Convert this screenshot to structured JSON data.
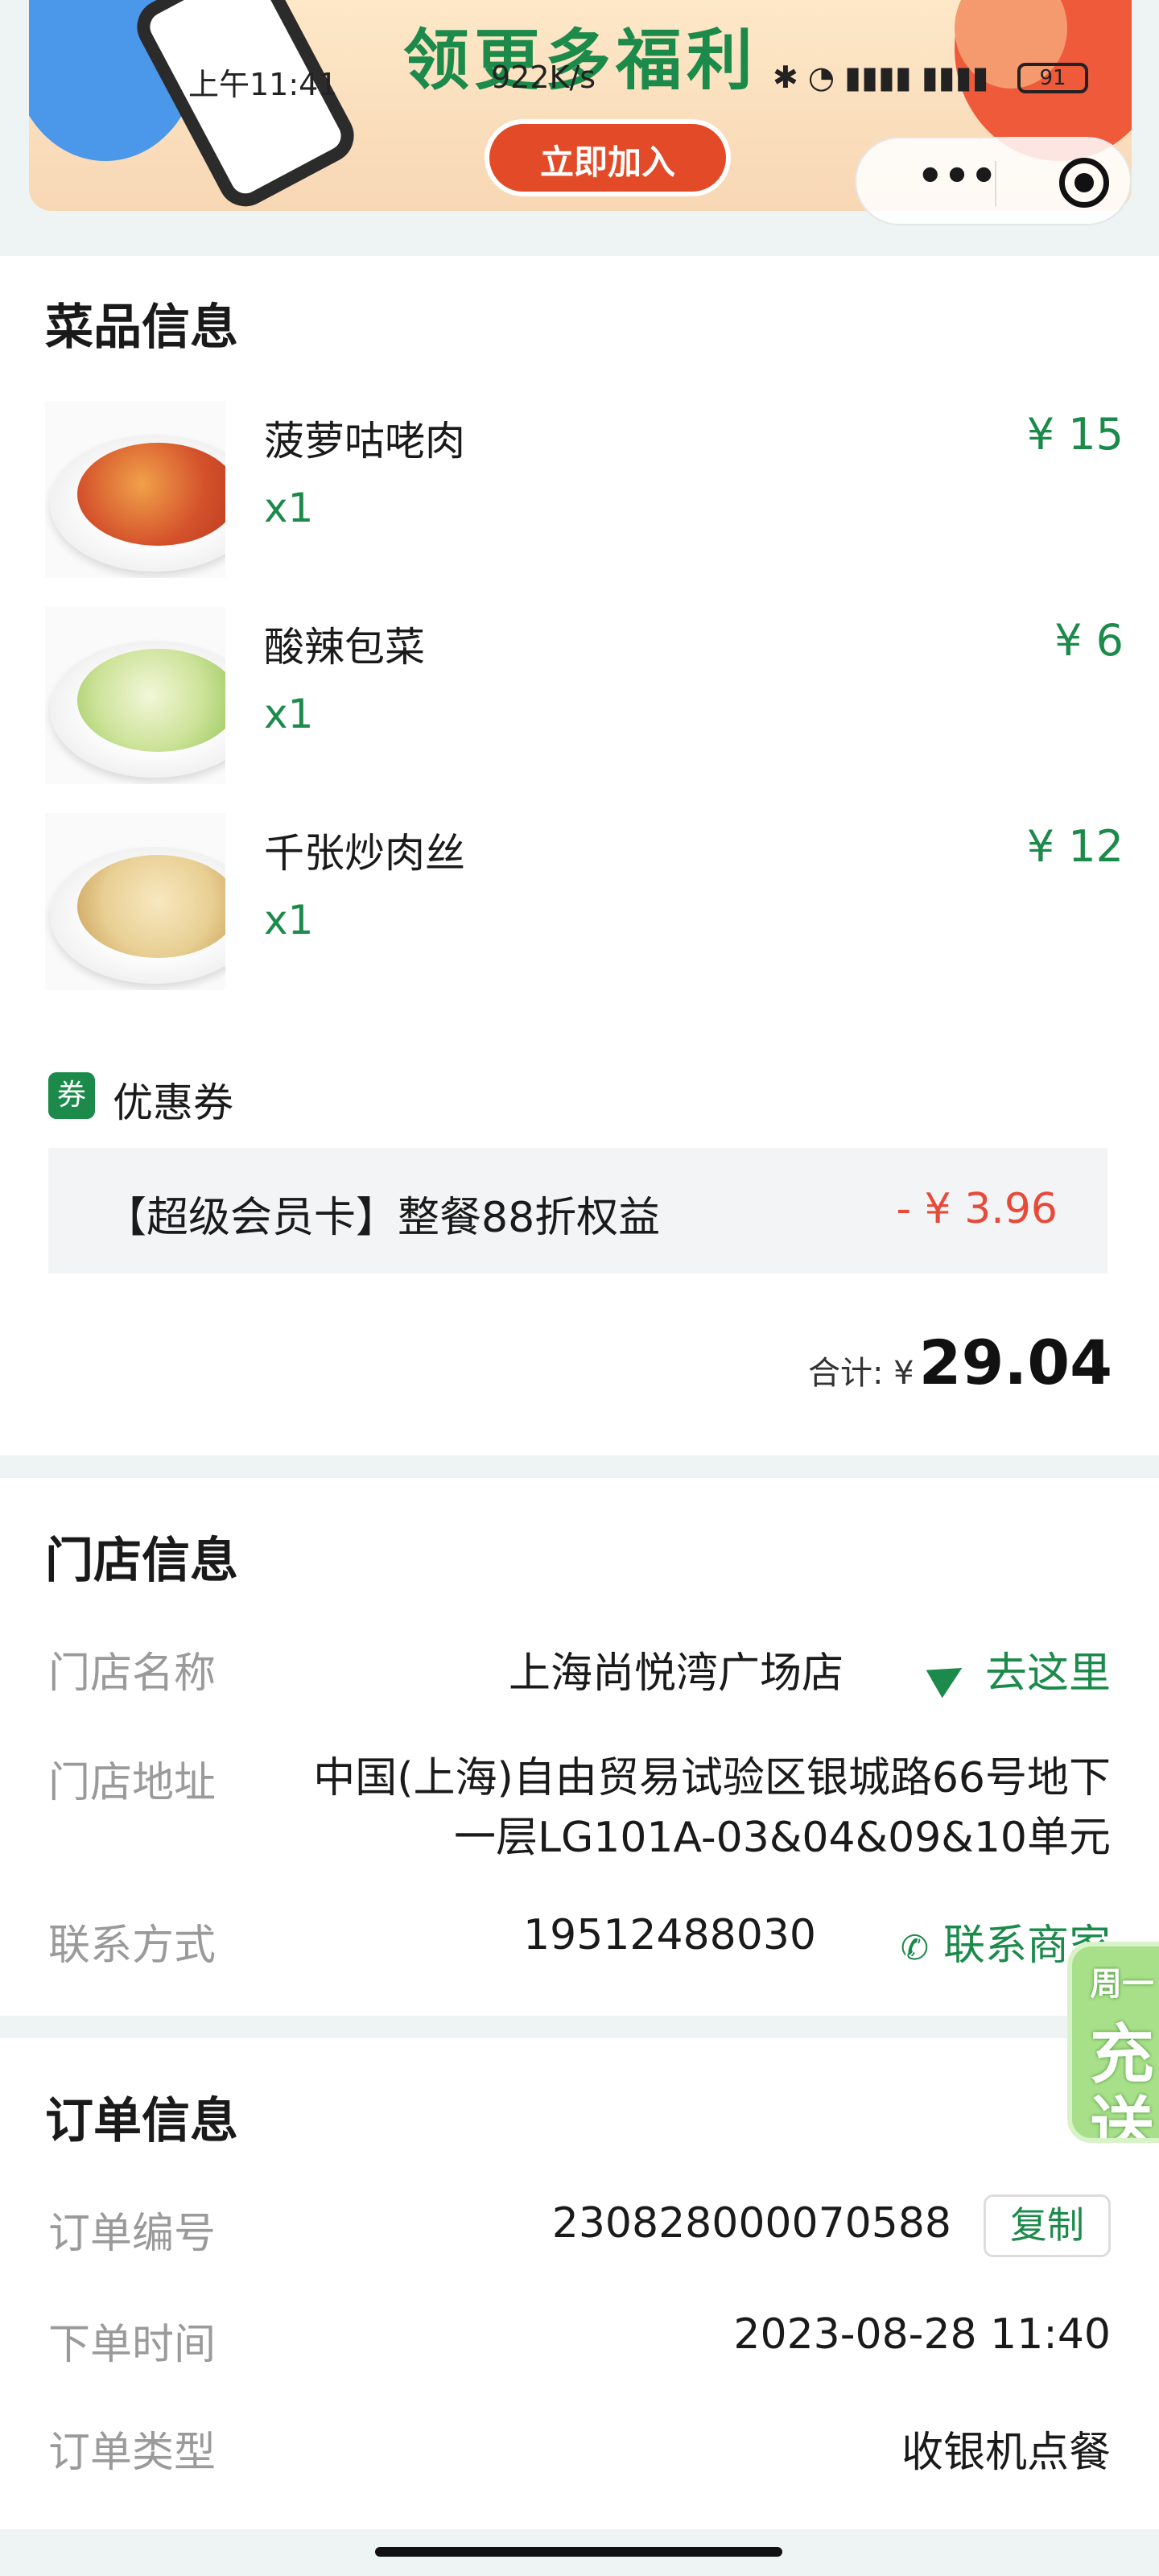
{
  "status_bar": {
    "time": "上午11:41",
    "speed": "922K/s",
    "battery": "91"
  },
  "banner": {
    "title": "领更多福利",
    "button_label": "立即加入"
  },
  "dishes_section": {
    "title": "菜品信息",
    "items": [
      {
        "name": "菠萝咕咾肉",
        "qty": "x1",
        "price": "¥ 15"
      },
      {
        "name": "酸辣包菜",
        "qty": "x1",
        "price": "¥ 6"
      },
      {
        "name": "千张炒肉丝",
        "qty": "x1",
        "price": "¥ 12"
      }
    ],
    "coupon_icon_text": "券",
    "coupon_label": "优惠券",
    "coupon_desc": "【超级会员卡】整餐88折权益",
    "coupon_amount": "- ¥ 3.96",
    "total_label": "合计: ¥",
    "total_value": "29.04"
  },
  "store_section": {
    "title": "门店信息",
    "name_label": "门店名称",
    "name_value": "上海尚悦湾广场店",
    "go_label": "去这里",
    "address_label": "门店地址",
    "address_value": "中国(上海)自由贸易试验区银城路66号地下一层LG101A-03&04&09&10单元",
    "contact_label": "联系方式",
    "contact_value": "19512488030",
    "contact_button": "联系商家"
  },
  "order_section": {
    "title": "订单信息",
    "no_label": "订单编号",
    "no_value": "230828000070588",
    "copy_label": "复制",
    "time_label": "下单时间",
    "time_value": "2023-08-28 11:40",
    "type_label": "订单类型",
    "type_value": "收银机点餐"
  },
  "float_promo": {
    "line1": "周一",
    "line2": "充",
    "line3": "送"
  },
  "colors": {
    "accent_green": "#1b8a4a",
    "discount_red": "#e84a3a",
    "page_bg": "#eef3f3"
  }
}
